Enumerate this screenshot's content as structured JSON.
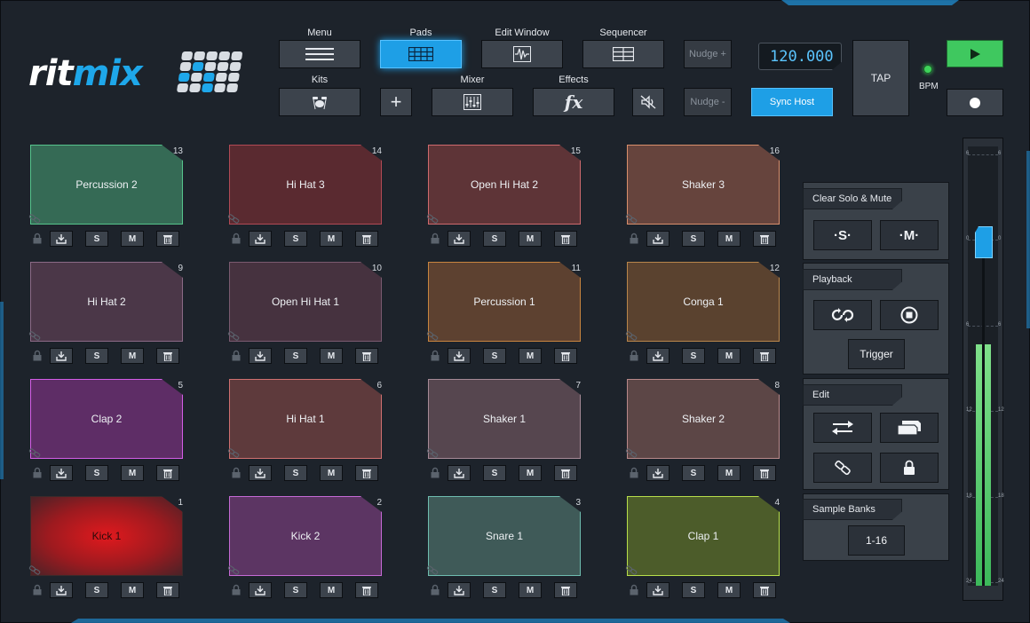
{
  "logo": {
    "text_white": "rit",
    "text_blue": "mix"
  },
  "toolbar": {
    "menu": {
      "label": "Menu",
      "icon": "hamburger-icon"
    },
    "pads": {
      "label": "Pads",
      "icon": "pad-grid-icon"
    },
    "edit_window": {
      "label": "Edit Window",
      "icon": "waveform-icon"
    },
    "sequencer": {
      "label": "Sequencer",
      "icon": "sequencer-grid-icon"
    },
    "kits": {
      "label": "Kits",
      "icon": "drum-kit-icon"
    },
    "mixer": {
      "label": "Mixer",
      "icon": "mixer-icon"
    },
    "effects": {
      "label": "Effects",
      "icon_text": "fx"
    },
    "add_glyph": "+",
    "nudge_plus": "Nudge +",
    "nudge_minus": "Nudge -",
    "sync_host": "Sync Host",
    "bpm_value": "120.000",
    "tap": "TAP",
    "bpm_label": "BPM"
  },
  "colors": {
    "accent": "#1e9fe6",
    "play": "#3fc85f"
  },
  "pads": [
    {
      "num": "13",
      "name": "Percussion 2",
      "bg": "#356a55",
      "border": "#56c48c"
    },
    {
      "num": "14",
      "name": "Hi Hat 3",
      "bg": "#5a2a30",
      "border": "#b24a55"
    },
    {
      "num": "15",
      "name": "Open Hi Hat 2",
      "bg": "#5e3437",
      "border": "#cf6a6e"
    },
    {
      "num": "16",
      "name": "Shaker 3",
      "bg": "#66443d",
      "border": "#d98f6c"
    },
    {
      "num": "9",
      "name": "Hi Hat 2",
      "bg": "#4b3748",
      "border": "#8b6a86"
    },
    {
      "num": "10",
      "name": "Open Hi Hat 1",
      "bg": "#46323f",
      "border": "#7a5a70"
    },
    {
      "num": "11",
      "name": "Percussion 1",
      "bg": "#5d4130",
      "border": "#c9853f"
    },
    {
      "num": "12",
      "name": "Conga 1",
      "bg": "#5a422f",
      "border": "#b9864b"
    },
    {
      "num": "5",
      "name": "Clap 2",
      "bg": "#5e2d66",
      "border": "#d45ee6"
    },
    {
      "num": "6",
      "name": "Hi Hat 1",
      "bg": "#5e3a3c",
      "border": "#d07070"
    },
    {
      "num": "7",
      "name": "Shaker 1",
      "bg": "#56464f",
      "border": "#a68a97"
    },
    {
      "num": "8",
      "name": "Shaker 2",
      "bg": "#5c4646",
      "border": "#b8898a"
    },
    {
      "num": "1",
      "name": "Kick 1",
      "bg": "#b51a1f",
      "border": "#3a2a2a",
      "text_color": "#2a0a0a"
    },
    {
      "num": "2",
      "name": "Kick 2",
      "bg": "#5c3563",
      "border": "#c66ad6"
    },
    {
      "num": "3",
      "name": "Snare 1",
      "bg": "#3f5a58",
      "border": "#6fbdb0"
    },
    {
      "num": "4",
      "name": "Clap 1",
      "bg": "#4c5c2a",
      "border": "#b8df4a"
    }
  ],
  "pad_controls": {
    "solo": "S",
    "mute": "M"
  },
  "right_panel": {
    "clear_solo_mute": {
      "title": "Clear Solo & Mute",
      "solo": "·S·",
      "mute": "·M·"
    },
    "playback": {
      "title": "Playback",
      "trigger": "Trigger"
    },
    "edit": {
      "title": "Edit"
    },
    "sample_banks": {
      "title": "Sample Banks",
      "value": "1-16"
    }
  },
  "meter": {
    "ticks": [
      "6",
      "0",
      "6",
      "12",
      "18",
      "24"
    ],
    "level_fraction": 0.55,
    "fader_label": "0"
  }
}
